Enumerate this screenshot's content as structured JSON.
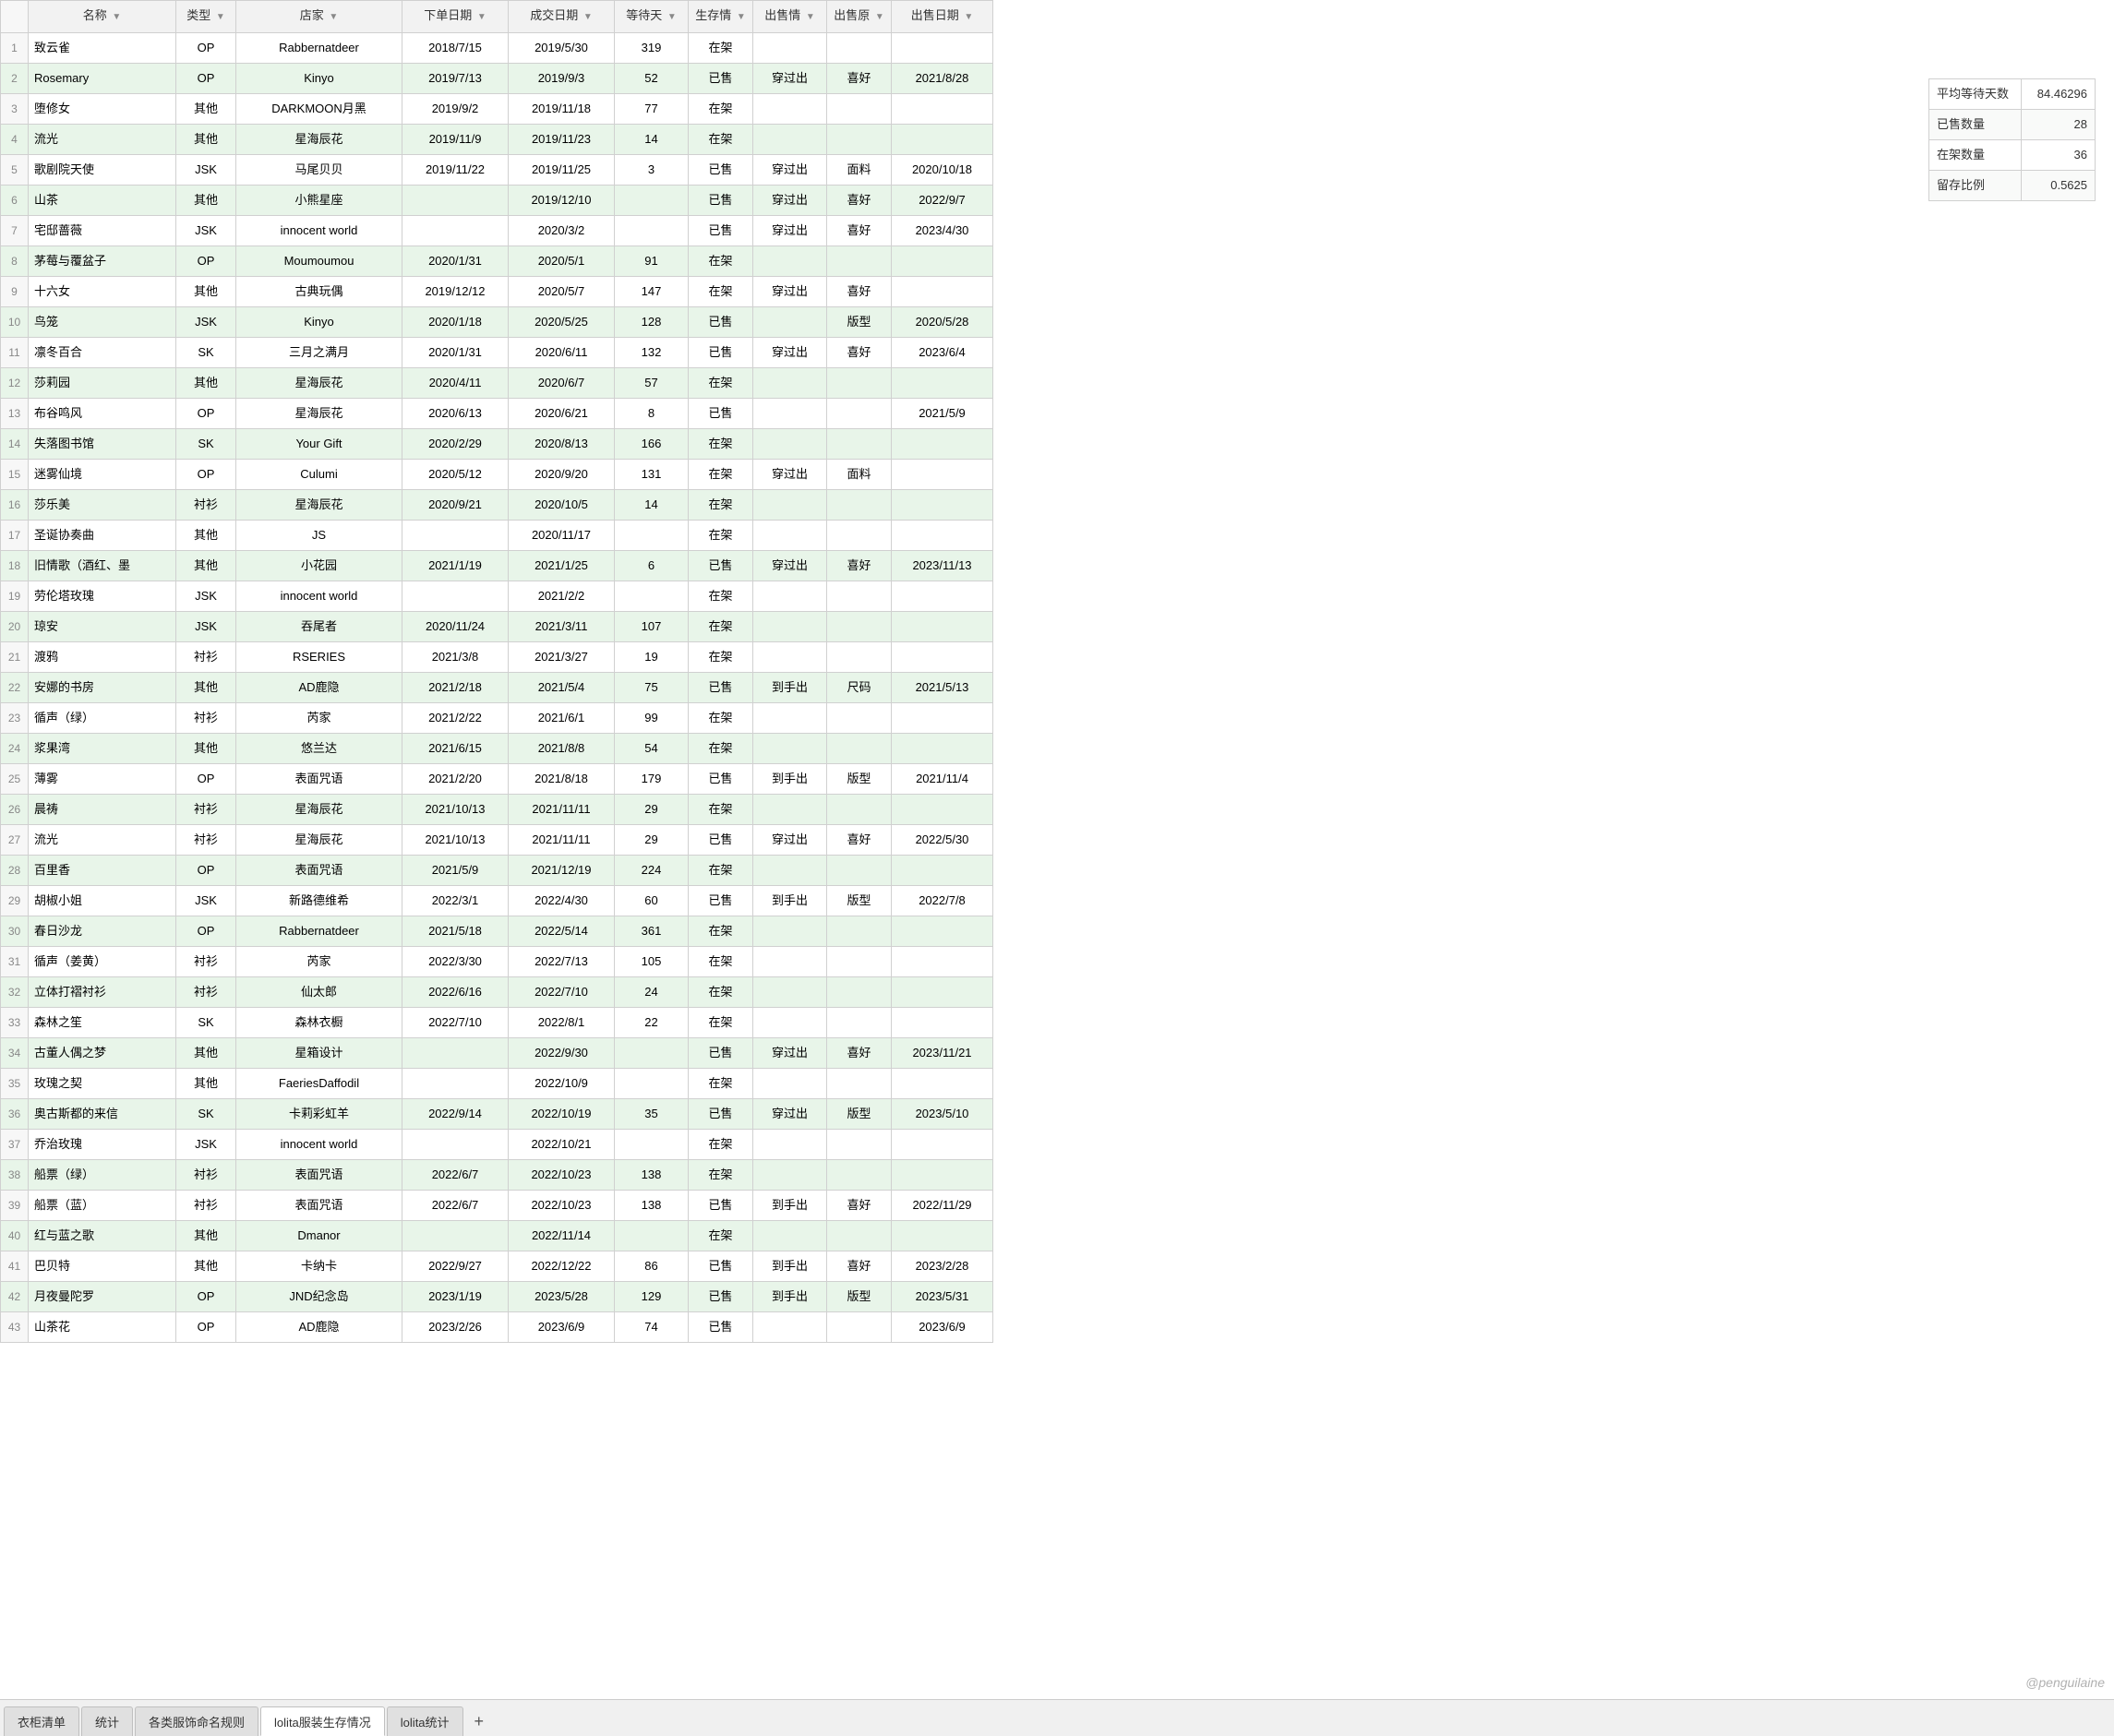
{
  "tabs": [
    {
      "label": "衣柜清单",
      "active": false
    },
    {
      "label": "统计",
      "active": false
    },
    {
      "label": "各类服饰命名规则",
      "active": false
    },
    {
      "label": "lolita服装生存情况",
      "active": true
    },
    {
      "label": "lolita统计",
      "active": false
    }
  ],
  "columns": [
    {
      "key": "name",
      "label": "名称",
      "has_filter": true
    },
    {
      "key": "type",
      "label": "类型",
      "has_filter": true
    },
    {
      "key": "store",
      "label": "店家",
      "has_filter": true
    },
    {
      "key": "order_date",
      "label": "下单日期",
      "has_filter": true
    },
    {
      "key": "deal_date",
      "label": "成交日期",
      "has_filter": true
    },
    {
      "key": "wait_days",
      "label": "等待天",
      "has_filter": true
    },
    {
      "key": "stock",
      "label": "生存情",
      "has_filter": true
    },
    {
      "key": "sell_info",
      "label": "出售情",
      "has_filter": true
    },
    {
      "key": "sell_reason",
      "label": "出售原",
      "has_filter": true
    },
    {
      "key": "sell_date",
      "label": "出售日期",
      "has_filter": true
    }
  ],
  "rows": [
    {
      "name": "致云雀",
      "type": "OP",
      "store": "Rabbernatdeer",
      "order_date": "2018/7/15",
      "deal_date": "2019/5/30",
      "wait_days": "319",
      "stock": "在架",
      "sell_info": "",
      "sell_reason": "",
      "sell_date": "",
      "highlight": false
    },
    {
      "name": "Rosemary",
      "type": "OP",
      "store": "Kinyo",
      "order_date": "2019/7/13",
      "deal_date": "2019/9/3",
      "wait_days": "52",
      "stock": "已售",
      "sell_info": "穿过出",
      "sell_reason": "喜好",
      "sell_date": "2021/8/28",
      "highlight": true
    },
    {
      "name": "堕修女",
      "type": "其他",
      "store": "DARKMOON月黑",
      "order_date": "2019/9/2",
      "deal_date": "2019/11/18",
      "wait_days": "77",
      "stock": "在架",
      "sell_info": "",
      "sell_reason": "",
      "sell_date": "",
      "highlight": false
    },
    {
      "name": "流光",
      "type": "其他",
      "store": "星海辰花",
      "order_date": "2019/11/9",
      "deal_date": "2019/11/23",
      "wait_days": "14",
      "stock": "在架",
      "sell_info": "",
      "sell_reason": "",
      "sell_date": "",
      "highlight": false
    },
    {
      "name": "歌剧院天使",
      "type": "JSK",
      "store": "马尾贝贝",
      "order_date": "2019/11/22",
      "deal_date": "2019/11/25",
      "wait_days": "3",
      "stock": "已售",
      "sell_info": "穿过出",
      "sell_reason": "面料",
      "sell_date": "2020/10/18",
      "highlight": false
    },
    {
      "name": "山茶",
      "type": "其他",
      "store": "小熊星座",
      "order_date": "",
      "deal_date": "2019/12/10",
      "wait_days": "",
      "stock": "已售",
      "sell_info": "穿过出",
      "sell_reason": "喜好",
      "sell_date": "2022/9/7",
      "highlight": false
    },
    {
      "name": "宅邸蔷薇",
      "type": "JSK",
      "store": "innocent world",
      "order_date": "",
      "deal_date": "2020/3/2",
      "wait_days": "",
      "stock": "已售",
      "sell_info": "穿过出",
      "sell_reason": "喜好",
      "sell_date": "2023/4/30",
      "highlight": false
    },
    {
      "name": "茅莓与覆盆子",
      "type": "OP",
      "store": "Moumoumou",
      "order_date": "2020/1/31",
      "deal_date": "2020/5/1",
      "wait_days": "91",
      "stock": "在架",
      "sell_info": "",
      "sell_reason": "",
      "sell_date": "",
      "highlight": false
    },
    {
      "name": "十六女",
      "type": "其他",
      "store": "古典玩偶",
      "order_date": "2019/12/12",
      "deal_date": "2020/5/7",
      "wait_days": "147",
      "stock": "在架",
      "sell_info": "穿过出",
      "sell_reason": "喜好",
      "sell_date": "",
      "highlight": false
    },
    {
      "name": "鸟笼",
      "type": "JSK",
      "store": "Kinyo",
      "order_date": "2020/1/18",
      "deal_date": "2020/5/25",
      "wait_days": "128",
      "stock": "已售",
      "sell_info": "",
      "sell_reason": "版型",
      "sell_date": "2020/5/28",
      "highlight": false
    },
    {
      "name": "凛冬百合",
      "type": "SK",
      "store": "三月之满月",
      "order_date": "2020/1/31",
      "deal_date": "2020/6/11",
      "wait_days": "132",
      "stock": "已售",
      "sell_info": "穿过出",
      "sell_reason": "喜好",
      "sell_date": "2023/6/4",
      "highlight": false
    },
    {
      "name": "莎莉园",
      "type": "其他",
      "store": "星海辰花",
      "order_date": "2020/4/11",
      "deal_date": "2020/6/7",
      "wait_days": "57",
      "stock": "在架",
      "sell_info": "",
      "sell_reason": "",
      "sell_date": "",
      "highlight": false
    },
    {
      "name": "布谷鸣风",
      "type": "OP",
      "store": "星海辰花",
      "order_date": "2020/6/13",
      "deal_date": "2020/6/21",
      "wait_days": "8",
      "stock": "已售",
      "sell_info": "",
      "sell_reason": "",
      "sell_date": "2021/5/9",
      "highlight": false
    },
    {
      "name": "失落图书馆",
      "type": "SK",
      "store": "Your Gift",
      "order_date": "2020/2/29",
      "deal_date": "2020/8/13",
      "wait_days": "166",
      "stock": "在架",
      "sell_info": "",
      "sell_reason": "",
      "sell_date": "",
      "highlight": false
    },
    {
      "name": "迷雾仙境",
      "type": "OP",
      "store": "Culumi",
      "order_date": "2020/5/12",
      "deal_date": "2020/9/20",
      "wait_days": "131",
      "stock": "在架",
      "sell_info": "穿过出",
      "sell_reason": "面料",
      "sell_date": "",
      "highlight": false
    },
    {
      "name": "莎乐美",
      "type": "衬衫",
      "store": "星海辰花",
      "order_date": "2020/9/21",
      "deal_date": "2020/10/5",
      "wait_days": "14",
      "stock": "在架",
      "sell_info": "",
      "sell_reason": "",
      "sell_date": "",
      "highlight": false
    },
    {
      "name": "圣诞协奏曲",
      "type": "其他",
      "store": "JS",
      "order_date": "",
      "deal_date": "2020/11/17",
      "wait_days": "",
      "stock": "在架",
      "sell_info": "",
      "sell_reason": "",
      "sell_date": "",
      "highlight": false
    },
    {
      "name": "旧情歌（酒红、墨",
      "type": "其他",
      "store": "小花园",
      "order_date": "2021/1/19",
      "deal_date": "2021/1/25",
      "wait_days": "6",
      "stock": "已售",
      "sell_info": "穿过出",
      "sell_reason": "喜好",
      "sell_date": "2023/11/13",
      "highlight": false
    },
    {
      "name": "劳伦塔玫瑰",
      "type": "JSK",
      "store": "innocent world",
      "order_date": "",
      "deal_date": "2021/2/2",
      "wait_days": "",
      "stock": "在架",
      "sell_info": "",
      "sell_reason": "",
      "sell_date": "",
      "highlight": false
    },
    {
      "name": "琼安",
      "type": "JSK",
      "store": "吞尾者",
      "order_date": "2020/11/24",
      "deal_date": "2021/3/11",
      "wait_days": "107",
      "stock": "在架",
      "sell_info": "",
      "sell_reason": "",
      "sell_date": "",
      "highlight": false
    },
    {
      "name": "渡鸦",
      "type": "衬衫",
      "store": "RSERIES",
      "order_date": "2021/3/8",
      "deal_date": "2021/3/27",
      "wait_days": "19",
      "stock": "在架",
      "sell_info": "",
      "sell_reason": "",
      "sell_date": "",
      "highlight": false
    },
    {
      "name": "安娜的书房",
      "type": "其他",
      "store": "AD鹿隐",
      "order_date": "2021/2/18",
      "deal_date": "2021/5/4",
      "wait_days": "75",
      "stock": "已售",
      "sell_info": "到手出",
      "sell_reason": "尺码",
      "sell_date": "2021/5/13",
      "highlight": false
    },
    {
      "name": "循声（绿）",
      "type": "衬衫",
      "store": "芮家",
      "order_date": "2021/2/22",
      "deal_date": "2021/6/1",
      "wait_days": "99",
      "stock": "在架",
      "sell_info": "",
      "sell_reason": "",
      "sell_date": "",
      "highlight": false
    },
    {
      "name": "浆果湾",
      "type": "其他",
      "store": "悠兰达",
      "order_date": "2021/6/15",
      "deal_date": "2021/8/8",
      "wait_days": "54",
      "stock": "在架",
      "sell_info": "",
      "sell_reason": "",
      "sell_date": "",
      "highlight": false
    },
    {
      "name": "薄雾",
      "type": "OP",
      "store": "表面咒语",
      "order_date": "2021/2/20",
      "deal_date": "2021/8/18",
      "wait_days": "179",
      "stock": "已售",
      "sell_info": "到手出",
      "sell_reason": "版型",
      "sell_date": "2021/11/4",
      "highlight": false
    },
    {
      "name": "晨祷",
      "type": "衬衫",
      "store": "星海辰花",
      "order_date": "2021/10/13",
      "deal_date": "2021/11/11",
      "wait_days": "29",
      "stock": "在架",
      "sell_info": "",
      "sell_reason": "",
      "sell_date": "",
      "highlight": false
    },
    {
      "name": "流光",
      "type": "衬衫",
      "store": "星海辰花",
      "order_date": "2021/10/13",
      "deal_date": "2021/11/11",
      "wait_days": "29",
      "stock": "已售",
      "sell_info": "穿过出",
      "sell_reason": "喜好",
      "sell_date": "2022/5/30",
      "highlight": false
    },
    {
      "name": "百里香",
      "type": "OP",
      "store": "表面咒语",
      "order_date": "2021/5/9",
      "deal_date": "2021/12/19",
      "wait_days": "224",
      "stock": "在架",
      "sell_info": "",
      "sell_reason": "",
      "sell_date": "",
      "highlight": false
    },
    {
      "name": "胡椒小姐",
      "type": "JSK",
      "store": "新路德维希",
      "order_date": "2022/3/1",
      "deal_date": "2022/4/30",
      "wait_days": "60",
      "stock": "已售",
      "sell_info": "到手出",
      "sell_reason": "版型",
      "sell_date": "2022/7/8",
      "highlight": false
    },
    {
      "name": "春日沙龙",
      "type": "OP",
      "store": "Rabbernatdeer",
      "order_date": "2021/5/18",
      "deal_date": "2022/5/14",
      "wait_days": "361",
      "stock": "在架",
      "sell_info": "",
      "sell_reason": "",
      "sell_date": "",
      "highlight": false
    },
    {
      "name": "循声（姜黄）",
      "type": "衬衫",
      "store": "芮家",
      "order_date": "2022/3/30",
      "deal_date": "2022/7/13",
      "wait_days": "105",
      "stock": "在架",
      "sell_info": "",
      "sell_reason": "",
      "sell_date": "",
      "highlight": false
    },
    {
      "name": "立体打褶衬衫",
      "type": "衬衫",
      "store": "仙太郎",
      "order_date": "2022/6/16",
      "deal_date": "2022/7/10",
      "wait_days": "24",
      "stock": "在架",
      "sell_info": "",
      "sell_reason": "",
      "sell_date": "",
      "highlight": false
    },
    {
      "name": "森林之笙",
      "type": "SK",
      "store": "森林衣橱",
      "order_date": "2022/7/10",
      "deal_date": "2022/8/1",
      "wait_days": "22",
      "stock": "在架",
      "sell_info": "",
      "sell_reason": "",
      "sell_date": "",
      "highlight": false
    },
    {
      "name": "古董人偶之梦",
      "type": "其他",
      "store": "星箱设计",
      "order_date": "",
      "deal_date": "2022/9/30",
      "wait_days": "",
      "stock": "已售",
      "sell_info": "穿过出",
      "sell_reason": "喜好",
      "sell_date": "2023/11/21",
      "highlight": false
    },
    {
      "name": "玫瑰之契",
      "type": "其他",
      "store": "FaeriesDaffodil",
      "order_date": "",
      "deal_date": "2022/10/9",
      "wait_days": "",
      "stock": "在架",
      "sell_info": "",
      "sell_reason": "",
      "sell_date": "",
      "highlight": false
    },
    {
      "name": "奥古斯都的来信",
      "type": "SK",
      "store": "卡莉彩虹羊",
      "order_date": "2022/9/14",
      "deal_date": "2022/10/19",
      "wait_days": "35",
      "stock": "已售",
      "sell_info": "穿过出",
      "sell_reason": "版型",
      "sell_date": "2023/5/10",
      "highlight": false
    },
    {
      "name": "乔治玫瑰",
      "type": "JSK",
      "store": "innocent world",
      "order_date": "",
      "deal_date": "2022/10/21",
      "wait_days": "",
      "stock": "在架",
      "sell_info": "",
      "sell_reason": "",
      "sell_date": "",
      "highlight": false
    },
    {
      "name": "船票（绿）",
      "type": "衬衫",
      "store": "表面咒语",
      "order_date": "2022/6/7",
      "deal_date": "2022/10/23",
      "wait_days": "138",
      "stock": "在架",
      "sell_info": "",
      "sell_reason": "",
      "sell_date": "",
      "highlight": false
    },
    {
      "name": "船票（蓝）",
      "type": "衬衫",
      "store": "表面咒语",
      "order_date": "2022/6/7",
      "deal_date": "2022/10/23",
      "wait_days": "138",
      "stock": "已售",
      "sell_info": "到手出",
      "sell_reason": "喜好",
      "sell_date": "2022/11/29",
      "highlight": false
    },
    {
      "name": "红与蓝之歌",
      "type": "其他",
      "store": "Dmanor",
      "order_date": "",
      "deal_date": "2022/11/14",
      "wait_days": "",
      "stock": "在架",
      "sell_info": "",
      "sell_reason": "",
      "sell_date": "",
      "highlight": false
    },
    {
      "name": "巴贝特",
      "type": "其他",
      "store": "卡纳卡",
      "order_date": "2022/9/27",
      "deal_date": "2022/12/22",
      "wait_days": "86",
      "stock": "已售",
      "sell_info": "到手出",
      "sell_reason": "喜好",
      "sell_date": "2023/2/28",
      "highlight": false
    },
    {
      "name": "月夜曼陀罗",
      "type": "OP",
      "store": "JND纪念岛",
      "order_date": "2023/1/19",
      "deal_date": "2023/5/28",
      "wait_days": "129",
      "stock": "已售",
      "sell_info": "到手出",
      "sell_reason": "版型",
      "sell_date": "2023/5/31",
      "highlight": false
    },
    {
      "name": "山茶花",
      "type": "OP",
      "store": "AD鹿隐",
      "order_date": "2023/2/26",
      "deal_date": "2023/6/9",
      "wait_days": "74",
      "stock": "已售",
      "sell_info": "",
      "sell_reason": "",
      "sell_date": "2023/6/9",
      "highlight": false
    }
  ],
  "stats": {
    "avg_wait_label": "平均等待天数",
    "avg_wait_value": "84.46296",
    "sold_label": "已售数量",
    "sold_value": "28",
    "on_shelf_label": "在架数量",
    "on_shelf_value": "36",
    "ratio_label": "留存比例",
    "ratio_value": "0.5625"
  },
  "watermark": "@penguilaine"
}
